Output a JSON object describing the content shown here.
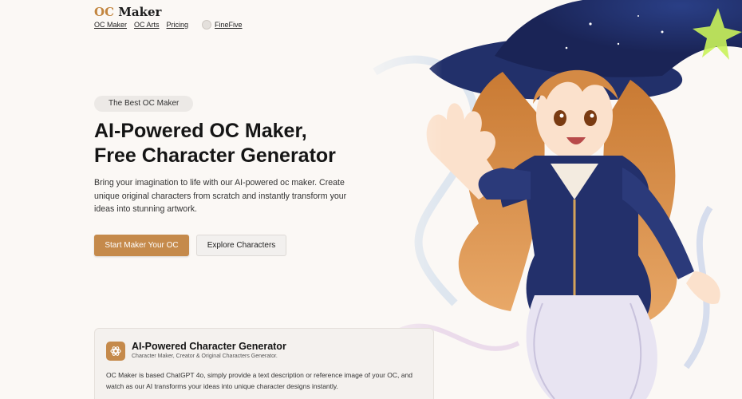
{
  "header": {
    "brand_accent": "OC",
    "brand_rest": "Maker",
    "nav": [
      "OC Maker",
      "OC Arts",
      "Pricing"
    ],
    "user_name": "FineFive"
  },
  "hero": {
    "badge": "The Best OC Maker",
    "title_line1": "AI-Powered OC Maker,",
    "title_line2": "Free Character Generator",
    "description": "Bring your imagination to life with our AI-powered oc maker. Create unique original characters from scratch and instantly transform your ideas into stunning artwork.",
    "primary_button": "Start Maker Your OC",
    "secondary_button": "Explore Characters"
  },
  "feature_card": {
    "icon": "openai-logo-icon",
    "title": "AI-Powered Character Generator",
    "subtitle": "Character Maker, Creator & Original Characters Generator.",
    "body": "OC Maker is based ChatGPT 4o, simply provide a text description or reference image of your OC, and watch as our AI transforms your ideas into unique character designs instantly."
  },
  "colors": {
    "accent": "#c58a4b",
    "background": "#fbf8f5"
  }
}
